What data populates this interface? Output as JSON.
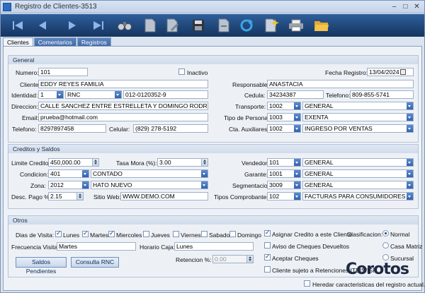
{
  "window": {
    "title": "Registro de Clientes-3513"
  },
  "icons": {
    "first": "first-icon",
    "prev": "prev-icon",
    "next": "next-icon",
    "last": "last-icon",
    "search": "binoculars-icon",
    "new": "new-doc-icon",
    "edit": "edit-doc-icon",
    "save": "save-icon",
    "delete": "delete-doc-icon",
    "refresh": "refresh-icon",
    "wizard": "wand-icon",
    "print": "print-icon",
    "open": "folder-icon"
  },
  "tabs": [
    "Clientes",
    "Comentarios",
    "Registros"
  ],
  "general": {
    "title": "General",
    "numero_label": "Numero:",
    "numero": "101",
    "inactivo_label": "Inactivo",
    "fecha_label": "Fecha Registro:",
    "fecha": "13/04/2024",
    "cliente_label": "Cliente:",
    "cliente": "EDDY  REYES FAMILIA",
    "responsable_label": "Responsable:",
    "responsable": "ANASTACIA",
    "identidad_label": "Identidad:",
    "identidad_num": "1",
    "identidad_tipo": "RNC",
    "identidad_valor": "012-0120352-9",
    "cedula_label": "Cedula:",
    "cedula": "34234387",
    "telefono2_label": "Telefono:",
    "telefono2": "809-855-5741",
    "direccion_label": "Direccion:",
    "direccion": "CALLE SANCHEZ ENTRE ESTRELLETA Y DOMINGO RODRIGUEZ",
    "transporte_label": "Transporte:",
    "transporte_cod": "1002",
    "transporte": "GENERAL",
    "email_label": "Email:",
    "email": "prueba@hotmail.com",
    "tipo_persona_label": "Tipo de Persona:",
    "tipo_persona_cod": "1003",
    "tipo_persona": "EXENTA",
    "telefono_label": "Telefono:",
    "telefono": "8297897458",
    "celular_label": "Celular:",
    "celular": "(829) 278-5192",
    "cta_label": "Cta. Auxiliares:",
    "cta_cod": "1002",
    "cta": "INGRESO POR VENTAS"
  },
  "creditos": {
    "title": "Creditos y Saldos",
    "limite_label": "Limite Credito:",
    "limite": "450,000.00",
    "tasa_label": "Tasa Mora (%):",
    "tasa": "3.00",
    "vendedor_label": "Vendedor:",
    "vendedor_cod": "101",
    "vendedor": "GENERAL",
    "condicion_label": "Condicion:",
    "condicion_cod": "401",
    "condicion": "CONTADO",
    "garante_label": "Garante:",
    "garante_cod": "1001",
    "garante": "GENERAL",
    "zona_label": "Zona:",
    "zona_cod": "2012",
    "zona": "HATO NUEVO",
    "segmentacion_label": "Segmentacion:",
    "segmentacion_cod": "3009",
    "segmentacion": "GENERAL",
    "desc_label": "Desc. Pago %:",
    "desc": "2.15",
    "web_label": "Sitio Web:",
    "web": "WWW.DEMO.COM",
    "comprob_label": "Tipos Comprobantes:",
    "comprob_cod": "102",
    "comprob": "FACTURAS PARA CONSUMIDORES FINALES"
  },
  "otros": {
    "title": "Otros",
    "dias_label": "Dias de Visita:",
    "dias": [
      {
        "label": "Lunes",
        "on": true
      },
      {
        "label": "Martes",
        "on": true
      },
      {
        "label": "Miercoles",
        "on": true
      },
      {
        "label": "Jueves",
        "on": false
      },
      {
        "label": "Viernes",
        "on": false
      },
      {
        "label": "Sabado",
        "on": false
      },
      {
        "label": "Domingo",
        "on": false
      }
    ],
    "frecuencia_label": "Frecuencia Visita:",
    "frecuencia": "Martes",
    "horario_label": "Horario Caja:",
    "horario": "Lunes",
    "retencion_label": "Retencion %:",
    "retencion": "0.00",
    "btn_saldos": "Saldos Pendientes",
    "btn_rnc": "Consulta RNC",
    "asignar": "Asignar Credito a este Cliente",
    "aviso": "Aviso de Cheques Devueltos",
    "aceptar": "Aceptar Cheques",
    "sujeto": "Cliente sujeto a Retenciones ITBIS/ISR",
    "clasif_label": "Clasificacion:",
    "clasif": [
      "Normal",
      "Casa Matriz",
      "Sucursal"
    ],
    "heredar": "Heredar caracteristicas del registro actual."
  },
  "watermark": "Corotos"
}
